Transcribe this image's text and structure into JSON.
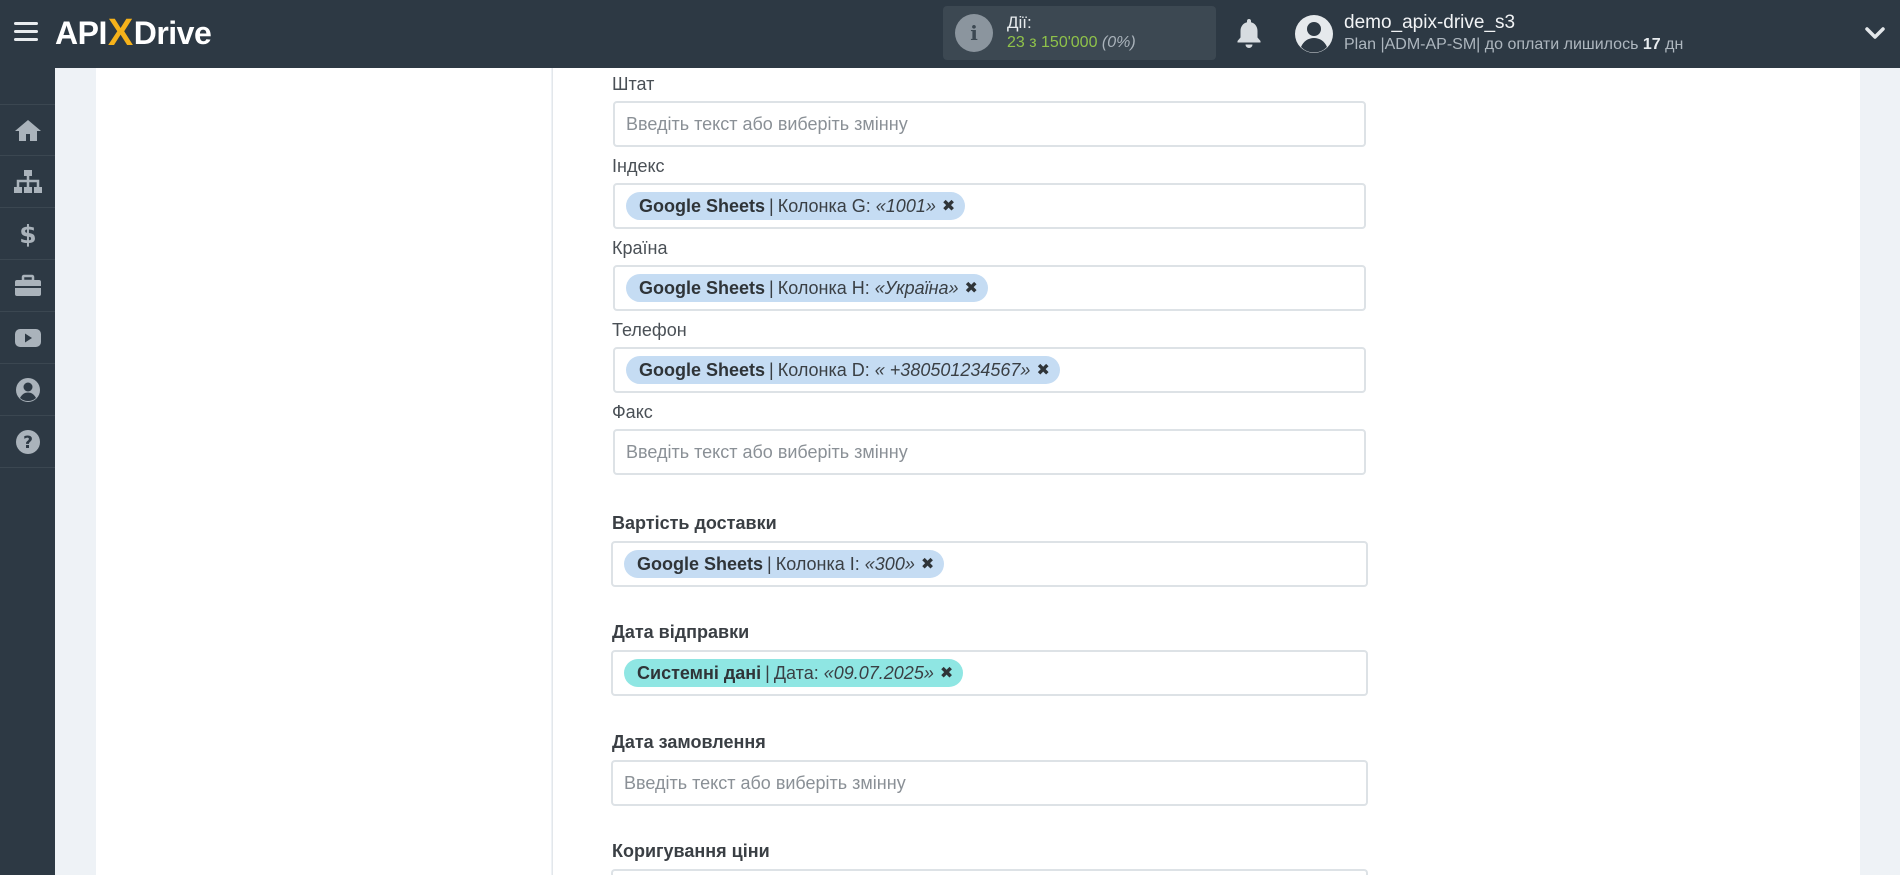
{
  "header": {
    "logo_api": "API",
    "logo_x": "X",
    "logo_drive": "Drive",
    "actions_label": "Дії:",
    "actions_count": "23 з 150'000",
    "actions_percent": "(0%)",
    "user_name": "demo_apix-drive_s3",
    "plan_prefix": "Plan |ADM-AP-SM| до оплати лишилось ",
    "plan_days": "17",
    "plan_suffix": " дн"
  },
  "sidebar": {
    "items": [
      "home-icon",
      "sitemap-icon",
      "dollar-icon",
      "briefcase-icon",
      "youtube-icon",
      "user-circle-icon",
      "help-icon"
    ]
  },
  "form": {
    "placeholder": "Введіть текст або виберіть змінну",
    "fields": [
      {
        "label": "Штат"
      },
      {
        "label": "Індекс",
        "tag": {
          "source": "Google Sheets",
          "sep": "|",
          "column": "Колонка G:",
          "value": "«1001»"
        }
      },
      {
        "label": "Країна",
        "tag": {
          "source": "Google Sheets",
          "sep": "|",
          "column": "Колонка H:",
          "value": "«Україна»"
        }
      },
      {
        "label": "Телефон",
        "tag": {
          "source": "Google Sheets",
          "sep": "|",
          "column": "Колонка D:",
          "value": "« +380501234567»"
        }
      },
      {
        "label": "Факс"
      },
      {
        "label": "Вартість доставки",
        "tag": {
          "source": "Google Sheets",
          "sep": "|",
          "column": "Колонка I:",
          "value": "«300»"
        }
      },
      {
        "label": "Дата відправки",
        "tag": {
          "source": "Системні дані",
          "sep": "|",
          "column": "Дата:",
          "value": "«09.07.2025»"
        }
      },
      {
        "label": "Дата замовлення"
      },
      {
        "label": "Коригування ціни"
      }
    ]
  },
  "colors": {
    "topbar": "#2d3944",
    "tag_google": "#c5dcf3",
    "tag_system": "#8fe6e3",
    "accent_green": "#8fc24a",
    "logo_accent": "#f6b21a"
  }
}
